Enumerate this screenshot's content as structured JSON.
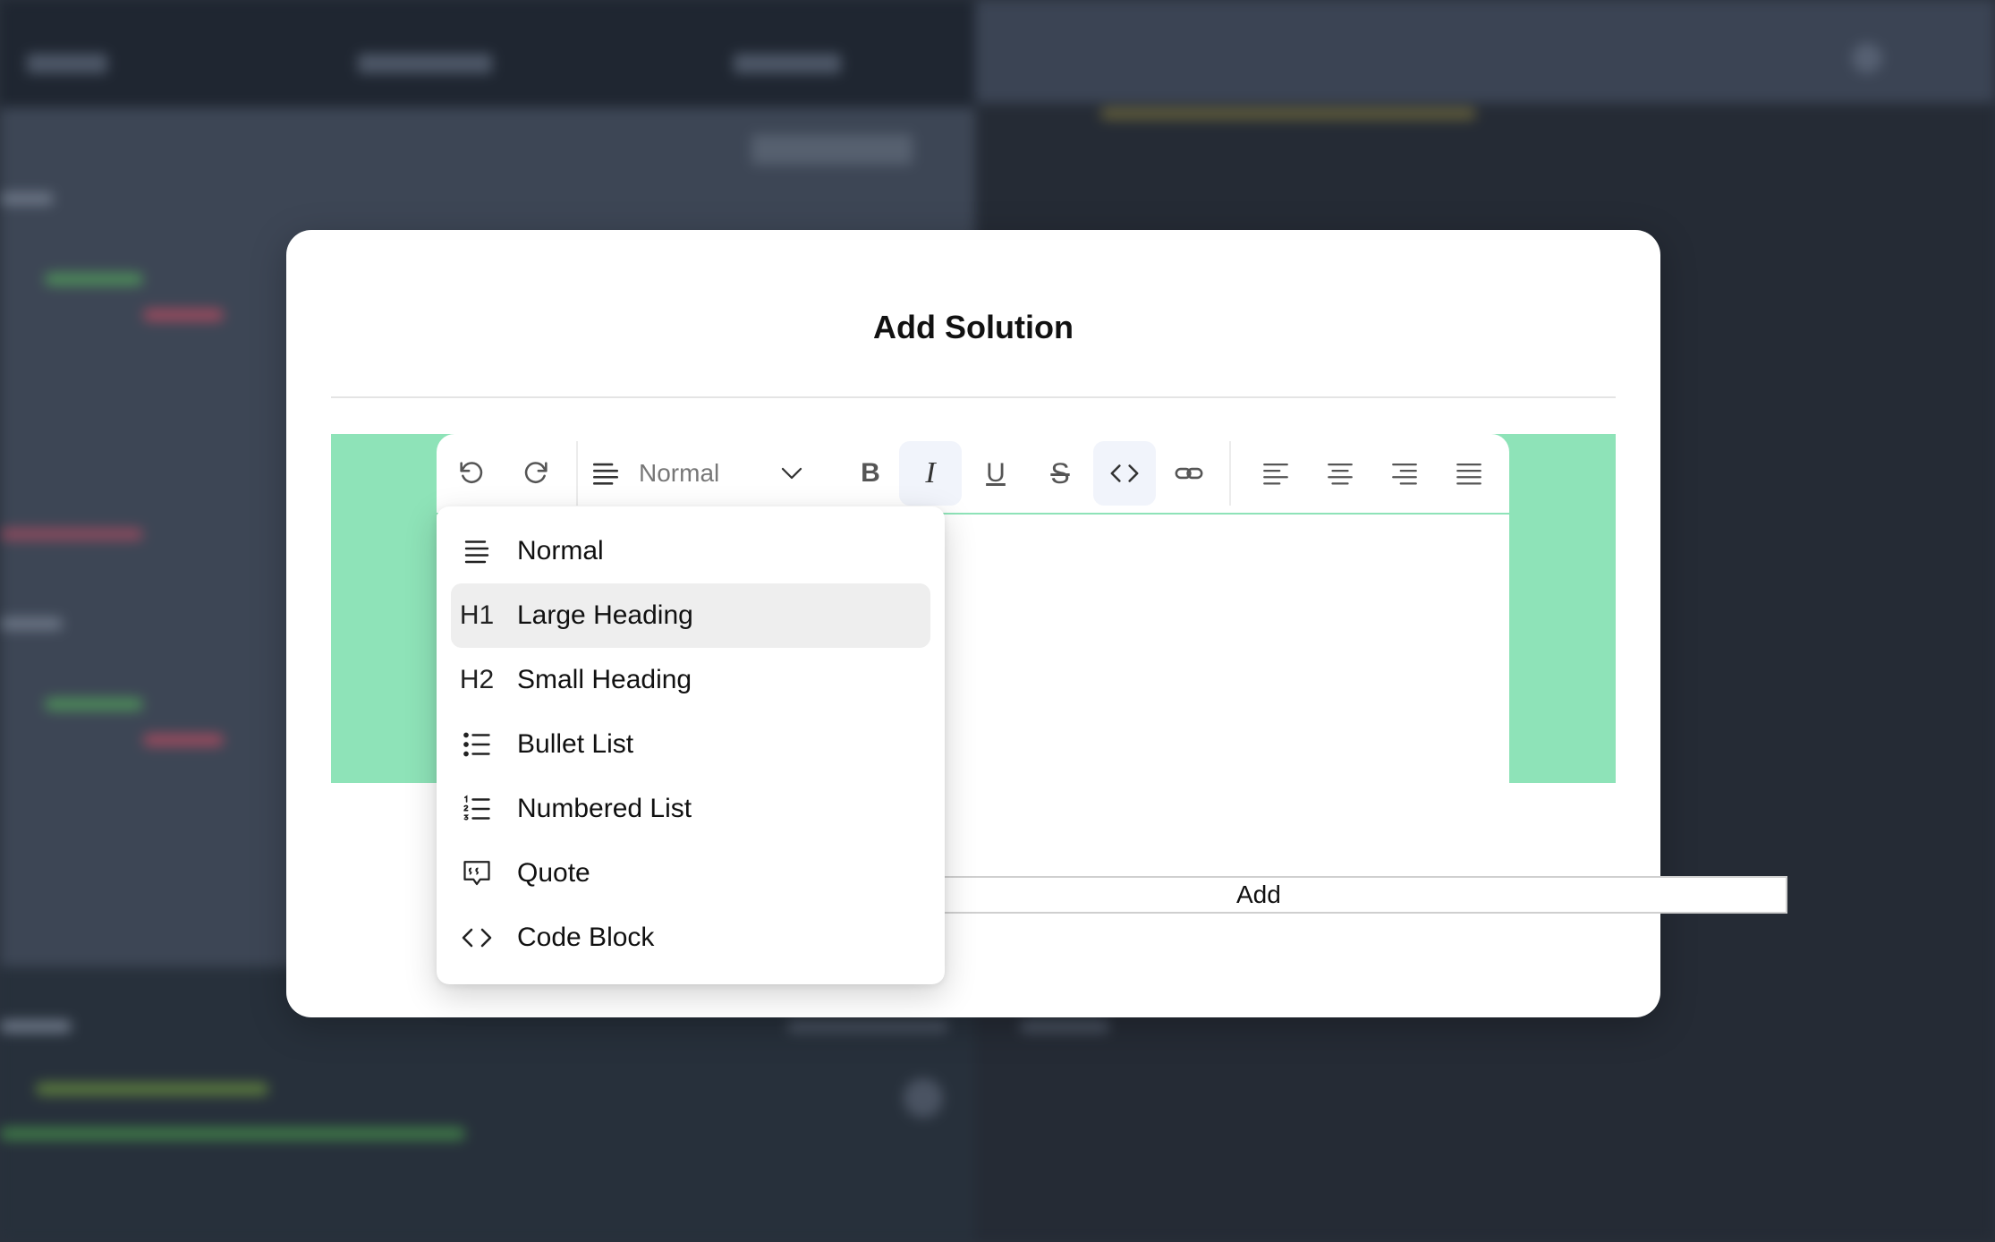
{
  "modal": {
    "title": "Add Solution"
  },
  "toolbar": {
    "block_type_value": "Normal",
    "buttons": [
      {
        "name": "undo-icon"
      },
      {
        "name": "redo-icon"
      },
      {
        "name": "bold-icon",
        "text": "B"
      },
      {
        "name": "italic-icon",
        "text": "I"
      },
      {
        "name": "underline-icon",
        "text": "U"
      },
      {
        "name": "strikethrough-icon",
        "text": "S"
      },
      {
        "name": "code-icon"
      },
      {
        "name": "link-icon"
      },
      {
        "name": "align-left-icon"
      },
      {
        "name": "align-center-icon"
      },
      {
        "name": "align-right-icon"
      },
      {
        "name": "align-justify-icon"
      }
    ],
    "italic_active": true,
    "code_active": true
  },
  "dropdown": {
    "items": [
      {
        "icon": "paragraph-lines-icon",
        "label": "Normal"
      },
      {
        "icon": "heading-1-icon",
        "icon_text": "H1",
        "label": "Large Heading",
        "highlighted": true
      },
      {
        "icon": "heading-2-icon",
        "icon_text": "H2",
        "label": "Small Heading"
      },
      {
        "icon": "bullet-list-icon",
        "label": "Bullet List"
      },
      {
        "icon": "numbered-list-icon",
        "label": "Numbered List"
      },
      {
        "icon": "quote-icon",
        "label": "Quote"
      },
      {
        "icon": "code-block-icon",
        "label": "Code Block"
      }
    ]
  },
  "add_button": {
    "label": "Add"
  },
  "colors": {
    "editor_accent": "#8ee3b8",
    "highlight": "#eeeeee"
  }
}
